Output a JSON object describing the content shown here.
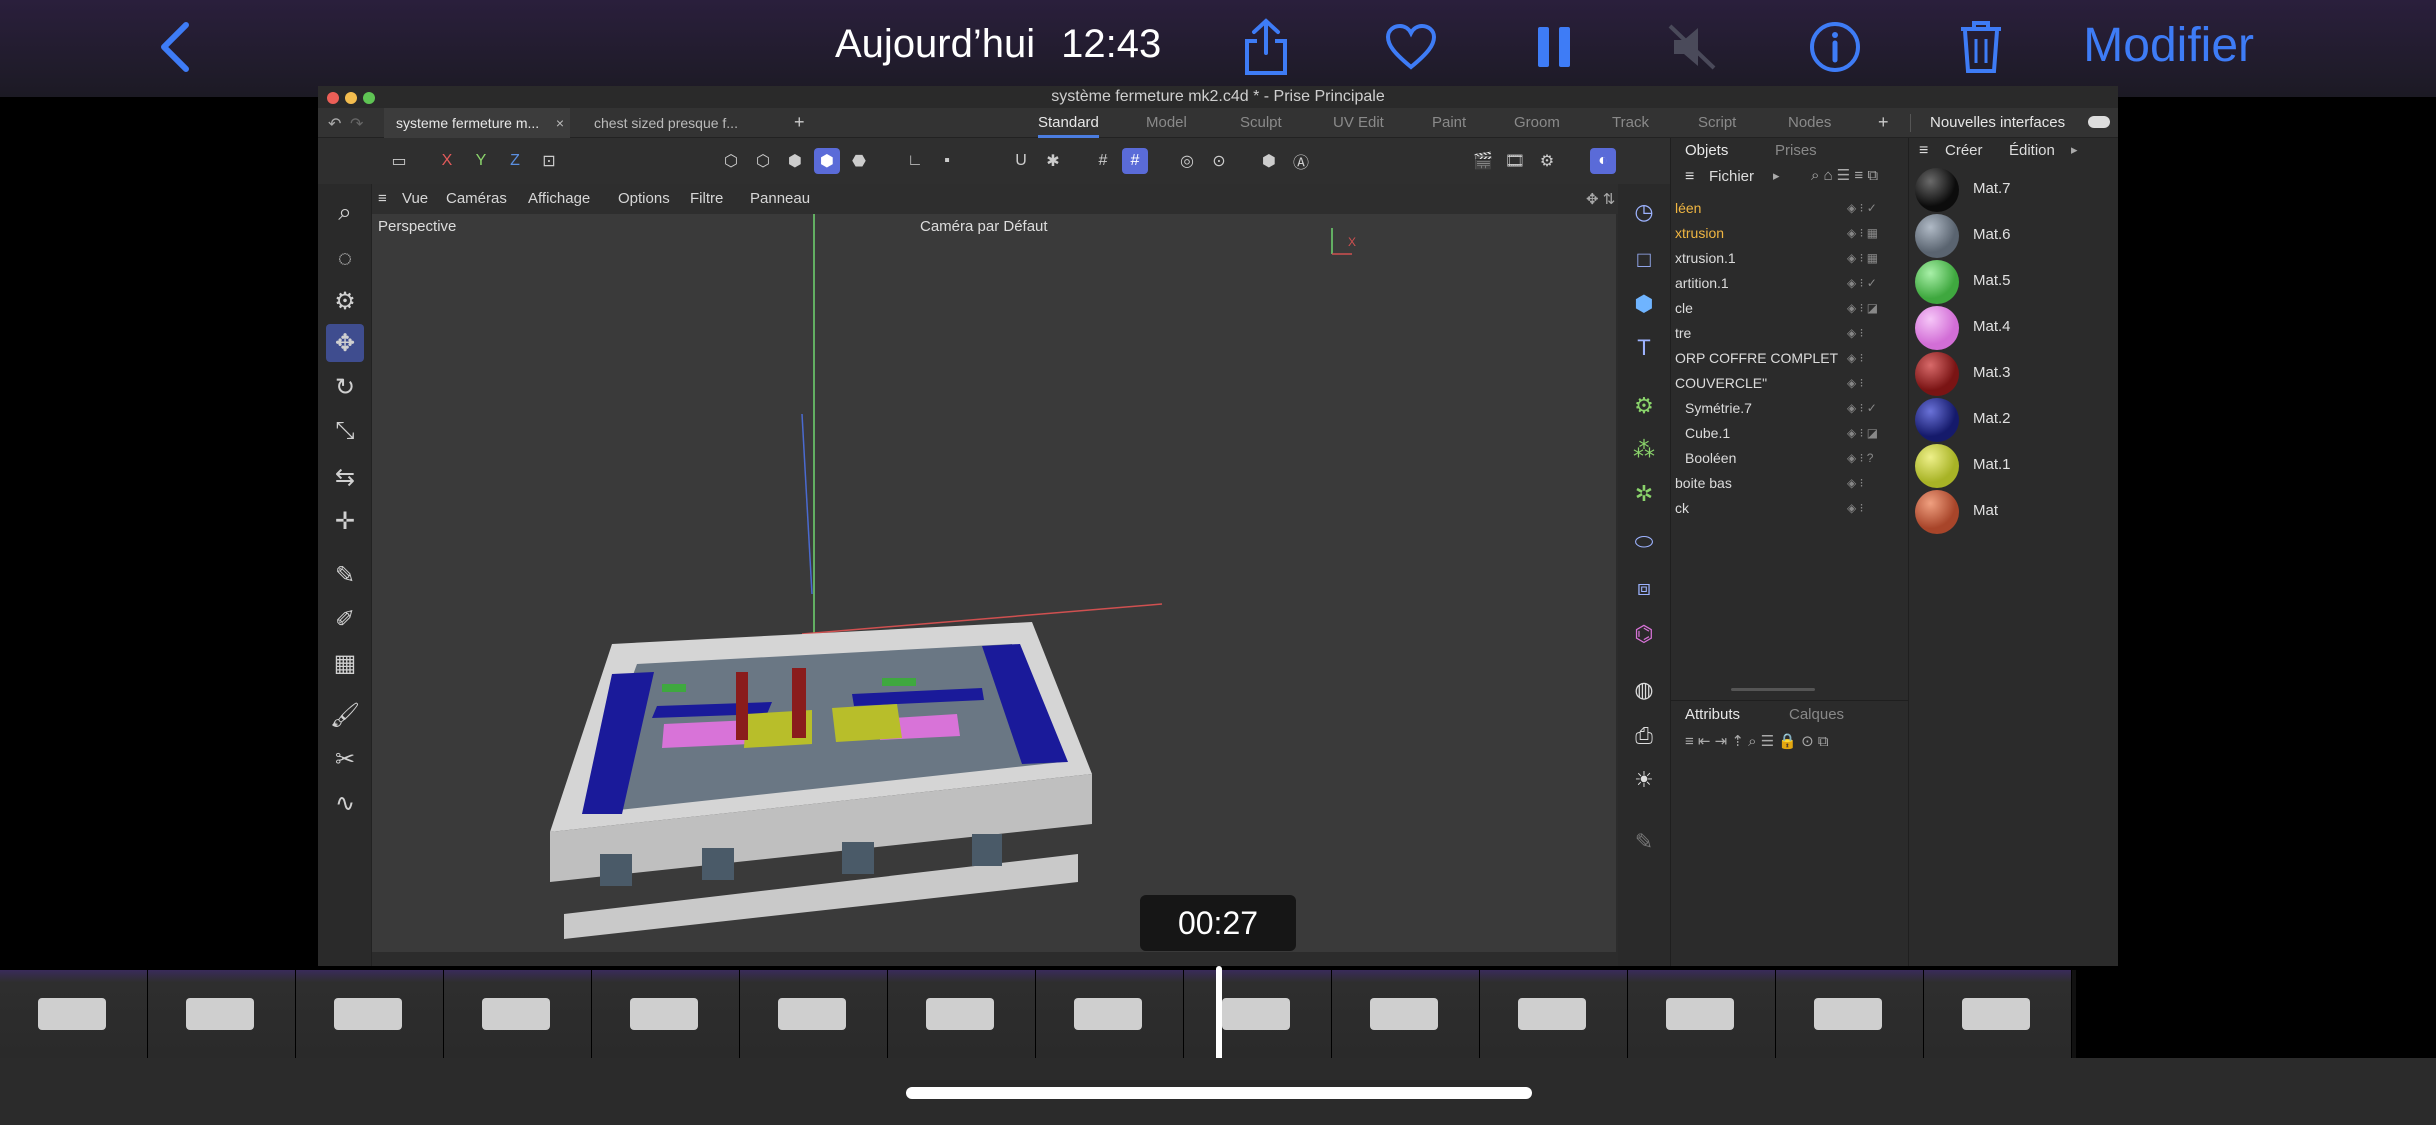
{
  "ios": {
    "date_label": "Aujourd’hui",
    "time_label": "12:43",
    "edit_label": "Modifier",
    "timer": "00:27"
  },
  "c4d": {
    "window_title": "système fermeture mk2.c4d * - Prise Principale",
    "doc_tabs": [
      "systeme fermeture m...",
      "chest sized presque f..."
    ],
    "layout_tabs": [
      "Standard",
      "Model",
      "Sculpt",
      "UV Edit",
      "Paint",
      "Groom",
      "Track",
      "Script",
      "Nodes"
    ],
    "nouvelles": "Nouvelles interfaces",
    "axis_labels": [
      "X",
      "Y",
      "Z"
    ],
    "view_menu": [
      "Vue",
      "Caméras",
      "Affichage",
      "Options",
      "Filtre",
      "Panneau"
    ],
    "viewport_label": "Perspective",
    "camera_label": "Caméra par Défaut",
    "objects_panel": {
      "tabs": [
        "Objets",
        "Prises"
      ],
      "menu": "Fichier",
      "rows": [
        "léen",
        "xtrusion",
        "xtrusion.1",
        "artition.1",
        "cle",
        "tre",
        "ORP COFFRE COMPLET",
        "COUVERCLE\"",
        "Symétrie.7",
        "Cube.1",
        "Booléen",
        "boite bas",
        "ck"
      ]
    },
    "attributes_panel": {
      "tabs": [
        "Attributs",
        "Calques"
      ]
    },
    "materials_panel": {
      "menu": [
        "Créer",
        "Édition"
      ],
      "materials": [
        {
          "name": "Mat.7",
          "color": "#0c0c0c"
        },
        {
          "name": "Mat.6",
          "color": "#5a6470"
        },
        {
          "name": "Mat.5",
          "color": "#3fa83f"
        },
        {
          "name": "Mat.4",
          "color": "#d26ed6"
        },
        {
          "name": "Mat.3",
          "color": "#7a1414"
        },
        {
          "name": "Mat.2",
          "color": "#151a6b"
        },
        {
          "name": "Mat.1",
          "color": "#a8b326"
        },
        {
          "name": "Mat",
          "color": "#a8452a"
        }
      ]
    }
  }
}
